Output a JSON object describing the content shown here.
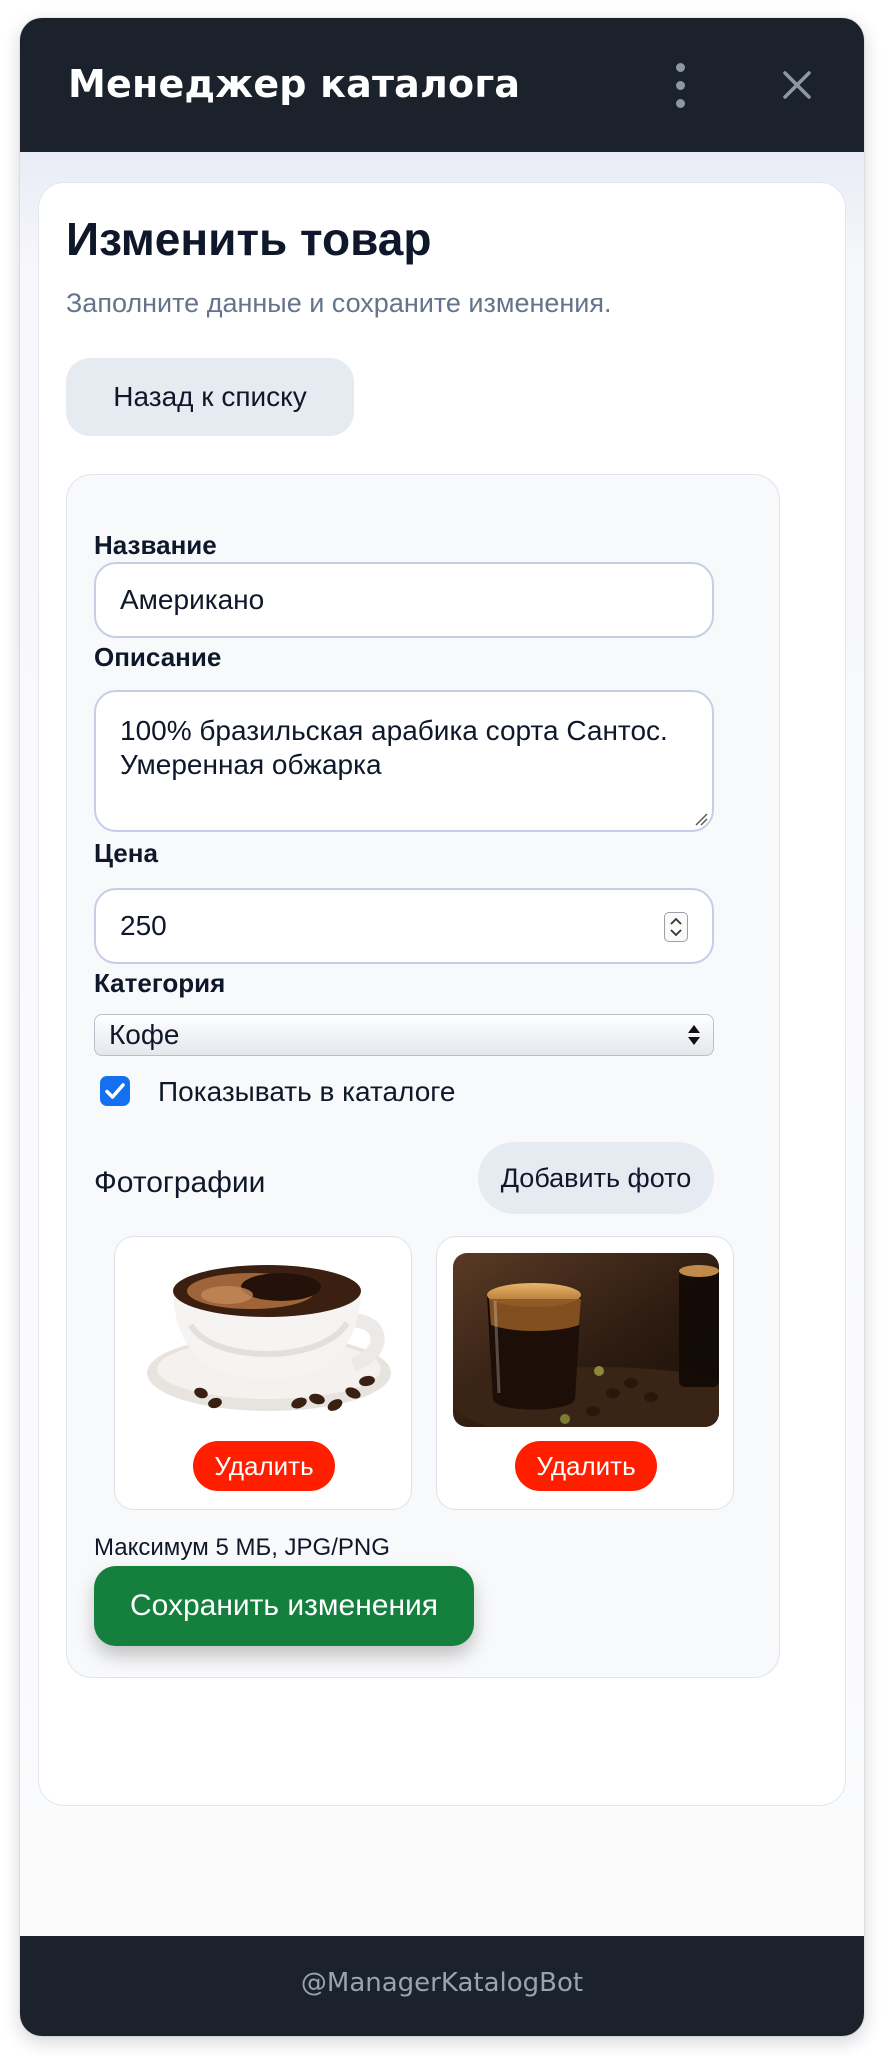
{
  "window": {
    "title": "Менеджер каталога"
  },
  "page": {
    "title": "Изменить товар",
    "subtitle": "Заполните данные и сохраните изменения.",
    "back_label": "Назад к списку"
  },
  "form": {
    "name_label": "Название",
    "name_value": "Американо",
    "description_label": "Описание",
    "description_value": "100% бразильская арабика сорта Сантос. Умеренная обжарка",
    "price_label": "Цена",
    "price_value": "250",
    "category_label": "Категория",
    "category_value": "Кофе",
    "show_in_catalog_label": "Показывать в каталоге",
    "show_in_catalog_checked": true
  },
  "photos": {
    "title": "Фотографии",
    "add_label": "Добавить фото",
    "items": [
      {
        "kind": "coffee-cup-photo",
        "delete_label": "Удалить"
      },
      {
        "kind": "espresso-glass-photo",
        "delete_label": "Удалить"
      }
    ],
    "hint": "Максимум 5 МБ, JPG/PNG"
  },
  "actions": {
    "save_label": "Сохранить изменения"
  },
  "footer": {
    "text": "@ManagerKatalogBot"
  },
  "colors": {
    "header_bg": "#1b222c",
    "save_green": "#157f3d",
    "delete_red": "#ff1f00",
    "checkbox_blue": "#1570ef",
    "subtitle_gray": "#64748b"
  }
}
